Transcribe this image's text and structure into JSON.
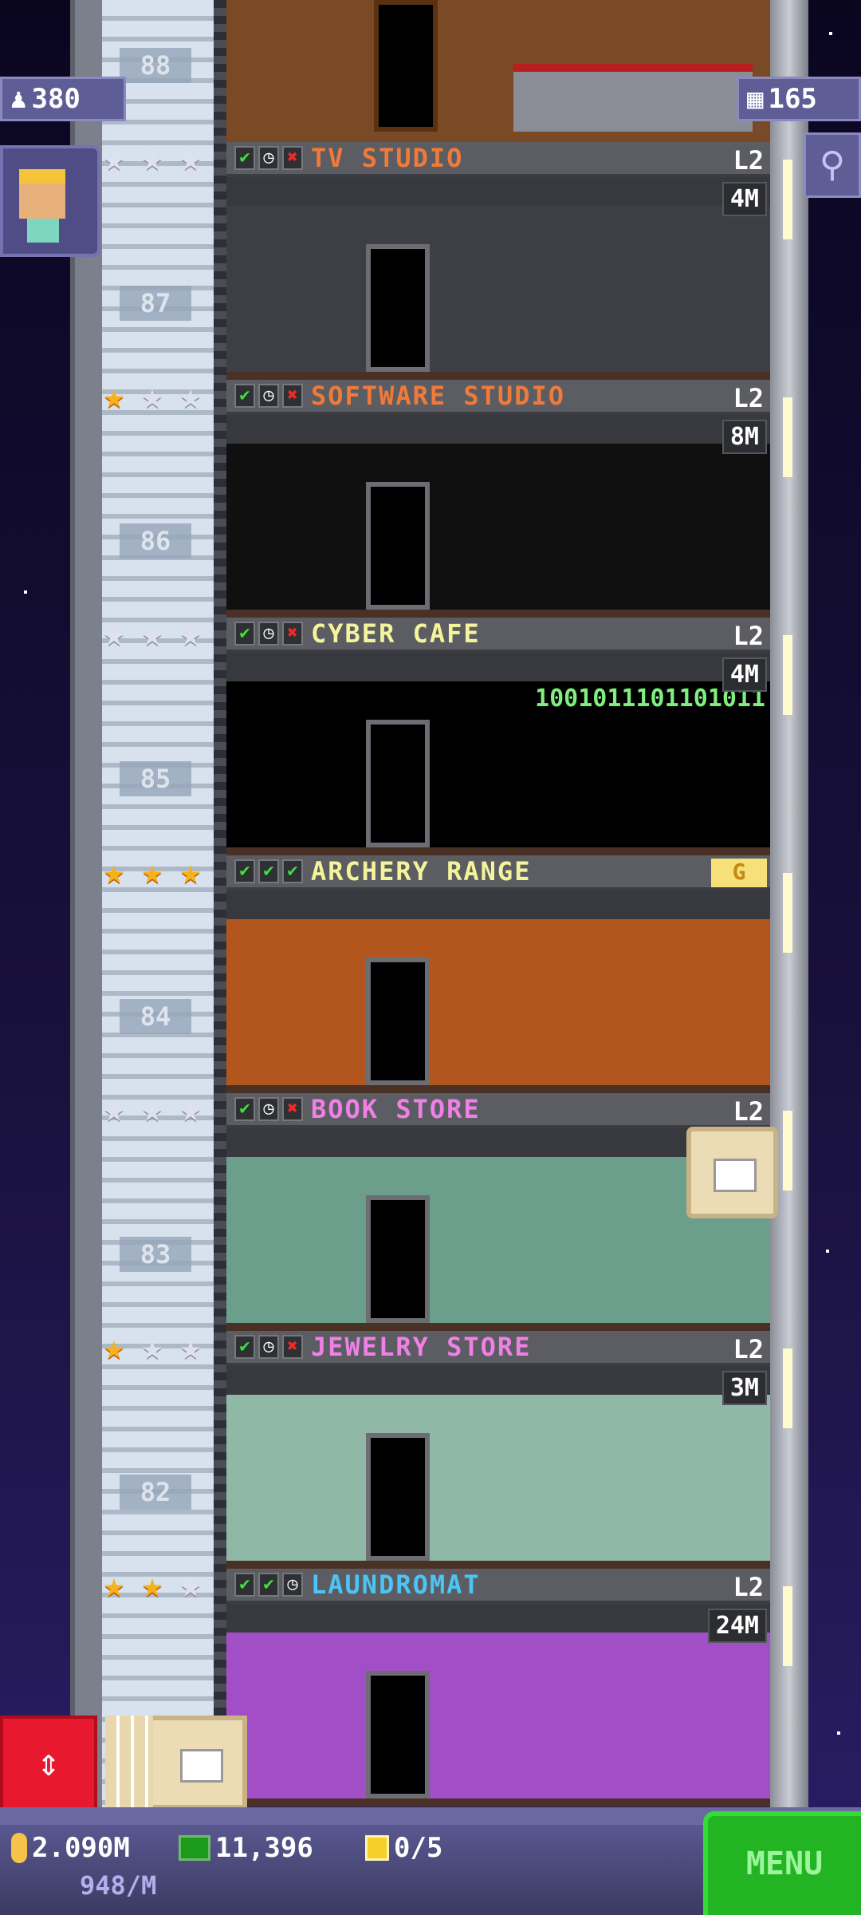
{
  "hud": {
    "population": "380",
    "floors_count": "165",
    "coins": "2.090M",
    "coin_rate": "948/M",
    "tower_bux": "11,396",
    "golden_tickets": "0/5",
    "menu_label": "MENU"
  },
  "top_floor": {
    "number": "88"
  },
  "floors": [
    {
      "number": "87",
      "name": "TV STUDIO",
      "color": "#f07a3a",
      "level": "L2",
      "stars": 0,
      "statuses": [
        "check",
        "clock",
        "x"
      ],
      "badge": "4M",
      "room_color": "#3e3f45"
    },
    {
      "number": "86",
      "name": "SOFTWARE STUDIO",
      "color": "#f07a3a",
      "level": "L2",
      "stars": 1,
      "statuses": [
        "check",
        "clock",
        "x"
      ],
      "badge": "8M",
      "room_color": "#101010"
    },
    {
      "number": "85",
      "name": "CYBER CAFE",
      "color": "#f4f49a",
      "level": "L2",
      "stars": 0,
      "statuses": [
        "check",
        "clock",
        "x"
      ],
      "badge": "4M",
      "room_color": "#000000",
      "screen_text": "1001011101101011"
    },
    {
      "number": "84",
      "name": "ARCHERY RANGE",
      "color": "#f4f49a",
      "level": "G",
      "stars": 3,
      "statuses": [
        "check",
        "check",
        "check"
      ],
      "badge": "",
      "room_color": "#b3561e"
    },
    {
      "number": "83",
      "name": "BOOK STORE",
      "color": "#f080e6",
      "level": "L2",
      "stars": 0,
      "statuses": [
        "check",
        "clock",
        "x"
      ],
      "badge": "",
      "room_color": "#6c9e8c"
    },
    {
      "number": "82",
      "name": "JEWELRY STORE",
      "color": "#f080e6",
      "level": "L2",
      "stars": 1,
      "statuses": [
        "check",
        "clock",
        "x"
      ],
      "badge": "3M",
      "room_color": "#8fb8a6"
    },
    {
      "number": "",
      "name": "LAUNDROMAT",
      "color": "#4cc4f4",
      "level": "L2",
      "stars": 2,
      "statuses": [
        "check",
        "check",
        "clock"
      ],
      "badge": "24M",
      "room_color": "#a24ec6"
    }
  ]
}
